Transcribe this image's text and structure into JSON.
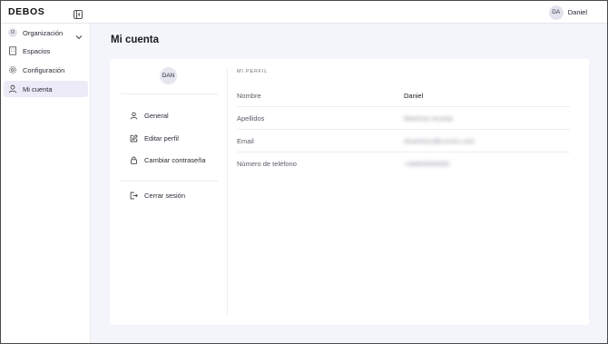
{
  "app": {
    "logo": "DEBOS"
  },
  "header": {
    "user_initials": "DA",
    "user_name": "Daniel"
  },
  "sidebar": {
    "items": [
      {
        "label": "Organización",
        "icon": "org-letter",
        "letter": "O",
        "has_chevron": true
      },
      {
        "label": "Espacios",
        "icon": "building-icon"
      },
      {
        "label": "Configuración",
        "icon": "gear-icon"
      },
      {
        "label": "Mi cuenta",
        "icon": "user-icon",
        "active": true
      }
    ]
  },
  "main": {
    "title": "Mi cuenta",
    "avatar_initials": "DAN",
    "menu": [
      {
        "label": "General",
        "icon": "user-icon"
      },
      {
        "label": "Editar perfil",
        "icon": "edit-icon"
      },
      {
        "label": "Cambiar contraseña",
        "icon": "lock-icon"
      },
      {
        "label": "Cerrar sesión",
        "icon": "logout-icon"
      }
    ],
    "profile": {
      "section_label": "MI PERFIL",
      "rows": [
        {
          "key": "Nombre",
          "value": "Daniel",
          "blurred": false
        },
        {
          "key": "Apellidos",
          "value": "Martínez Acosta",
          "blurred": true
        },
        {
          "key": "Email",
          "value": "dmartinez@correo.com",
          "blurred": true
        },
        {
          "key": "Número de teléfono",
          "value": "+34600000000",
          "blurred": true
        }
      ]
    }
  },
  "colors": {
    "background": "#f4f4fb",
    "active_item": "#ecebf7",
    "avatar": "#e3e3ee"
  }
}
